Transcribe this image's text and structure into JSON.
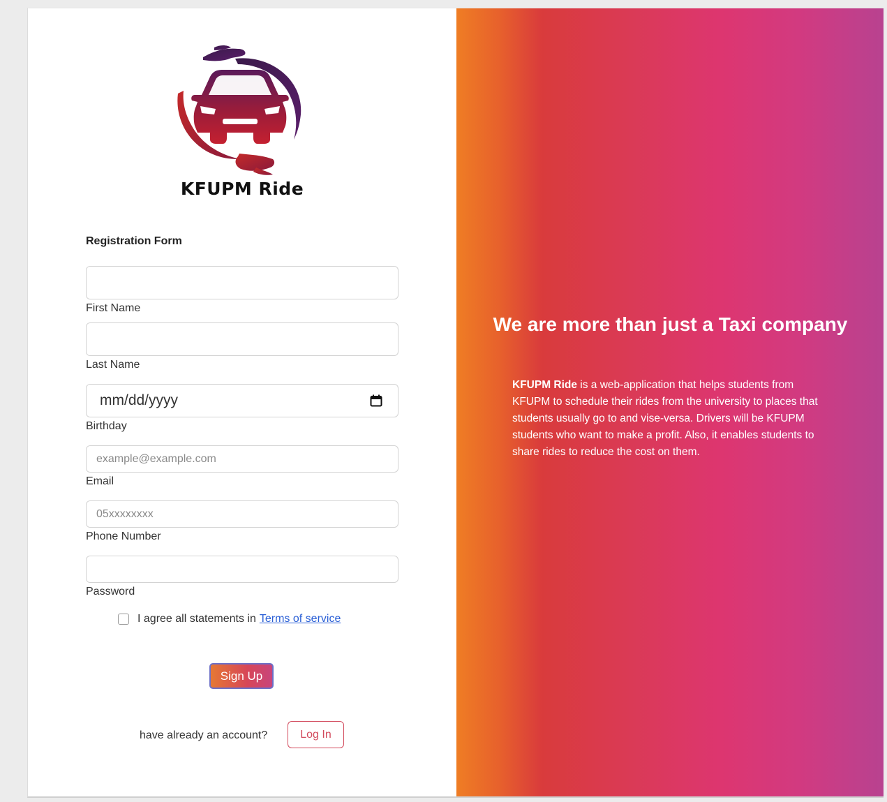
{
  "brand": {
    "name": "KFUPM Ride",
    "logo_icon": "car-with-hands-icon"
  },
  "form": {
    "title": "Registration Form",
    "fields": {
      "first_name": {
        "label": "First Name",
        "value": "",
        "placeholder": ""
      },
      "last_name": {
        "label": "Last Name",
        "value": "",
        "placeholder": ""
      },
      "birthday": {
        "label": "Birthday",
        "placeholder": "mm/dd/yyyy",
        "icon": "calendar-icon"
      },
      "email": {
        "label": "Email",
        "value": "",
        "placeholder": "example@example.com"
      },
      "phone": {
        "label": "Phone Number",
        "value": "",
        "placeholder": "05xxxxxxxx"
      },
      "password": {
        "label": "Password",
        "value": "",
        "placeholder": ""
      }
    },
    "agree": {
      "text": "I agree all statements in",
      "link": "Terms of service",
      "checked": false
    },
    "signup_label": "Sign Up",
    "already_text": "have already an account?",
    "login_label": "Log In"
  },
  "promo": {
    "headline": "We are more than just a Taxi company",
    "brand_bold": "KFUPM Ride",
    "description": " is a web-application that helps students from KFUPM to schedule their rides from the university to places that students usually go to and vise-versa. Drivers will be KFUPM students who want to make a profit. Also, it enables students to share rides to reduce the cost on them."
  },
  "colors": {
    "gradient_start": "#ef7d24",
    "gradient_mid": "#dd3670",
    "gradient_end": "#b84290",
    "link": "#2a5fd6",
    "login_accent": "#d24a5c"
  }
}
